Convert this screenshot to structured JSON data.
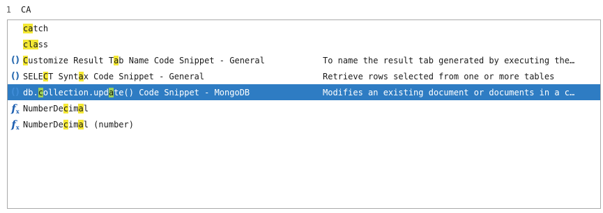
{
  "editor": {
    "line_number": "1",
    "line_text": "CA"
  },
  "completion": {
    "items": [
      {
        "icon": "none",
        "segments": [
          [
            "ca",
            true
          ],
          [
            "tch",
            false
          ]
        ],
        "description": "",
        "selected": false
      },
      {
        "icon": "none",
        "segments": [
          [
            "cla",
            true
          ],
          [
            "ss",
            false
          ]
        ],
        "description": "",
        "selected": false
      },
      {
        "icon": "snippet-icon",
        "segments": [
          [
            "C",
            true
          ],
          [
            "ustomize Result T",
            false
          ],
          [
            "a",
            true
          ],
          [
            "b Name Code Snippet - General",
            false
          ]
        ],
        "description": "To name the result tab generated by executing the…",
        "selected": false
      },
      {
        "icon": "snippet-icon",
        "segments": [
          [
            "SELE",
            false
          ],
          [
            "C",
            true
          ],
          [
            "T Synt",
            false
          ],
          [
            "a",
            true
          ],
          [
            "x Code Snippet - General",
            false
          ]
        ],
        "description": "Retrieve rows selected from one or more tables",
        "selected": false
      },
      {
        "icon": "snippet-icon",
        "segments": [
          [
            "db.",
            false
          ],
          [
            "c",
            true
          ],
          [
            "ollection.upd",
            false
          ],
          [
            "a",
            true
          ],
          [
            "te() Code Snippet - MongoDB",
            false
          ]
        ],
        "description": "Modifies an existing document or documents in a c…",
        "selected": true
      },
      {
        "icon": "function-icon",
        "segments": [
          [
            "NumberDe",
            false
          ],
          [
            "c",
            true
          ],
          [
            "im",
            false
          ],
          [
            "a",
            true
          ],
          [
            "l",
            false
          ]
        ],
        "description": "",
        "selected": false
      },
      {
        "icon": "function-icon",
        "segments": [
          [
            "NumberDe",
            false
          ],
          [
            "c",
            true
          ],
          [
            "im",
            false
          ],
          [
            "a",
            true
          ],
          [
            "l (number)",
            false
          ]
        ],
        "description": "",
        "selected": false
      }
    ]
  }
}
